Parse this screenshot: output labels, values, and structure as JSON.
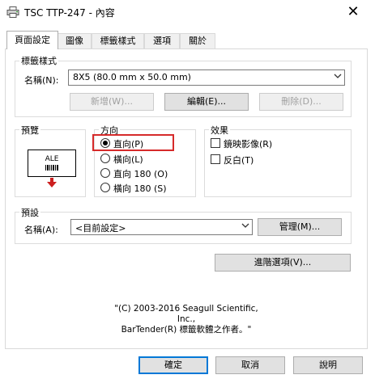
{
  "window": {
    "title": "TSC TTP-247 - 內容",
    "close_symbol": "✕"
  },
  "tabs": [
    {
      "label": "頁面設定",
      "active": true
    },
    {
      "label": "圖像",
      "active": false
    },
    {
      "label": "標籤樣式",
      "active": false
    },
    {
      "label": "選項",
      "active": false
    },
    {
      "label": "關於",
      "active": false
    }
  ],
  "label_style": {
    "group_title": "標籤樣式",
    "name_label": "名稱(N):",
    "name_value": "8X5 (80.0 mm x 50.0 mm)",
    "new_button": "新增(W)...",
    "edit_button": "編輯(E)...",
    "delete_button": "刪除(D)..."
  },
  "preview": {
    "group_title": "預覽",
    "label_text": "ALE",
    "arrow_color": "#cc1f1f"
  },
  "orientation": {
    "group_title": "方向",
    "options": [
      {
        "label": "直向(P)",
        "selected": true
      },
      {
        "label": "橫向(L)",
        "selected": false
      },
      {
        "label": "直向 180 (O)",
        "selected": false
      },
      {
        "label": "橫向 180 (S)",
        "selected": false
      }
    ],
    "highlight_color": "#d62a2a"
  },
  "effects": {
    "group_title": "效果",
    "mirror_label": "鏡映影像(R)",
    "invert_label": "反白(T)",
    "mirror_checked": false,
    "invert_checked": false
  },
  "preset": {
    "group_title": "預設",
    "name_label": "名稱(A):",
    "name_value": "<目前設定>",
    "manage_button": "管理(M)..."
  },
  "advanced_button": "進階選項(V)...",
  "copyright": {
    "line1": "\"(C) 2003-2016 Seagull Scientific, Inc.,",
    "line2": "BarTender(R) 標籤軟體之作者。\""
  },
  "footer_buttons": {
    "ok": "確定",
    "cancel": "取消",
    "help": "說明"
  }
}
